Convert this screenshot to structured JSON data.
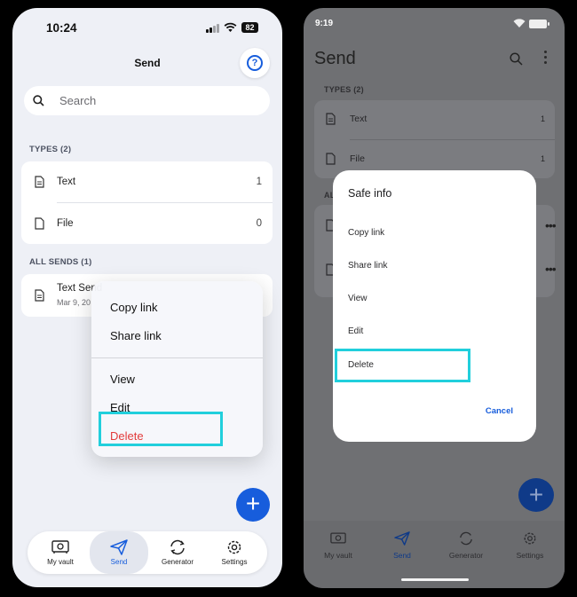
{
  "ios": {
    "status": {
      "time": "10:24",
      "battery": "82"
    },
    "title": "Send",
    "search": {
      "placeholder": "Search"
    },
    "types_header": "TYPES (2)",
    "types": [
      {
        "label": "Text",
        "count": "1"
      },
      {
        "label": "File",
        "count": "0"
      }
    ],
    "all_sends_header": "ALL SENDS (1)",
    "send_item": {
      "name": "Text Send",
      "date": "Mar 9, 20"
    },
    "menu": {
      "copy_link": "Copy link",
      "share_link": "Share link",
      "view": "View",
      "edit": "Edit",
      "delete": "Delete"
    },
    "tabs": [
      "My vault",
      "Send",
      "Generator",
      "Settings"
    ],
    "fab": "+"
  },
  "android": {
    "status": {
      "time": "9:19"
    },
    "title": "Send",
    "types_header": "TYPES (2)",
    "types": [
      {
        "label": "Text",
        "count": "1"
      },
      {
        "label": "File",
        "count": "1"
      }
    ],
    "all_header": "AL",
    "dialog": {
      "title": "Safe info",
      "items": [
        "Copy link",
        "Share link",
        "View",
        "Edit",
        "Delete"
      ],
      "cancel": "Cancel"
    },
    "tabs": [
      "My vault",
      "Send",
      "Generator",
      "Settings"
    ],
    "fab": "+"
  },
  "colors": {
    "accent": "#175ddc",
    "delete": "#e23b3b",
    "highlight": "#21cfdc"
  }
}
